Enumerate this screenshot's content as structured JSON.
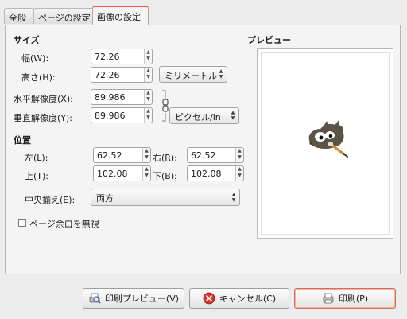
{
  "tabs": [
    {
      "label": "全般"
    },
    {
      "label": "ページの設定"
    },
    {
      "label": "画像の設定"
    }
  ],
  "size_section": {
    "title": "サイズ",
    "width_label": "幅(W):",
    "width_value": "72.26",
    "height_label": "高さ(H):",
    "height_value": "72.26",
    "unit": "ミリメートル",
    "xres_label": "水平解像度(X):",
    "xres_value": "89.986",
    "yres_label": "垂直解像度(Y):",
    "yres_value": "89.986",
    "res_unit": "ピクセル/in"
  },
  "position_section": {
    "title": "位置",
    "left_label": "左(L):",
    "left_value": "62.52",
    "right_label": "右(R):",
    "right_value": "62.52",
    "top_label": "上(T):",
    "top_value": "102.08",
    "bottom_label": "下(B):",
    "bottom_value": "102.08",
    "center_label": "中央揃え(E):",
    "center_value": "両方"
  },
  "ignore_margins": {
    "label": "ページ余白を無視",
    "checked": false
  },
  "preview": {
    "title": "プレビュー"
  },
  "buttons": {
    "print_preview": "印刷プレビュー(V)",
    "cancel": "キャンセル(C)",
    "print": "印刷(P)"
  },
  "colors": {
    "active_tab_accent": "#e8614a",
    "cancel_icon": "#d8322a"
  }
}
